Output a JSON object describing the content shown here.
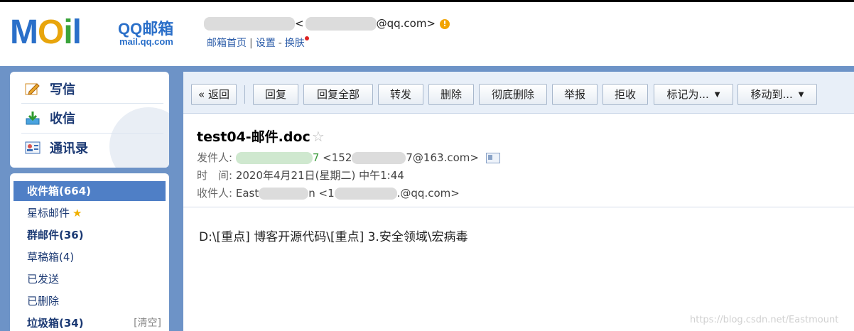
{
  "brand": {
    "logo_text": "MOil",
    "product": "QQ邮箱",
    "domain": "mail.qq.com"
  },
  "account": {
    "open": "<",
    "email_suffix": "@qq.com>"
  },
  "toplinks": {
    "home": "邮箱首页",
    "sep1": "|",
    "settings": "设置",
    "sep2": "-",
    "skin": "换肤"
  },
  "quick_actions": [
    {
      "label": "写信",
      "icon": "pencil-icon"
    },
    {
      "label": "收信",
      "icon": "inbox-download-icon"
    },
    {
      "label": "通讯录",
      "icon": "contacts-card-icon"
    }
  ],
  "folders": [
    {
      "label": "收件箱(664)"
    },
    {
      "label": "星标邮件"
    },
    {
      "label": "群邮件(36)"
    },
    {
      "label": "草稿箱(4)"
    },
    {
      "label": "已发送"
    },
    {
      "label": "已删除"
    },
    {
      "label": "垃圾箱(34)",
      "action": "[清空]"
    }
  ],
  "toolbar": {
    "back": "« 返回",
    "reply": "回复",
    "reply_all": "回复全部",
    "forward": "转发",
    "delete": "删除",
    "delete_perm": "彻底删除",
    "report": "举报",
    "reject": "拒收",
    "mark_as": "标记为...",
    "move_to": "移动到..."
  },
  "mail": {
    "subject": "test04-邮件.doc",
    "from_label": "发件人:",
    "from_visible_tail": "7",
    "from_addr_prefix": "<152",
    "from_addr_suffix": "7@163.com>",
    "time_label": "时　间:",
    "time_value": "2020年4月21日(星期二) 中午1:44",
    "to_label": "收件人:",
    "to_name_head": "East",
    "to_name_tail": "n",
    "to_addr_prefix": "<1",
    "to_addr_suffix": ".@qq.com>",
    "body": "D:\\[重点] 博客开源代码\\[重点] 3.安全领域\\宏病毒"
  },
  "watermark": "https://blog.csdn.net/Eastmount",
  "colors": {
    "brand_blue": "#2a6fc9",
    "panel_blue": "#6d93c7",
    "active_folder": "#4f7fc6",
    "warning": "#f2a400"
  }
}
